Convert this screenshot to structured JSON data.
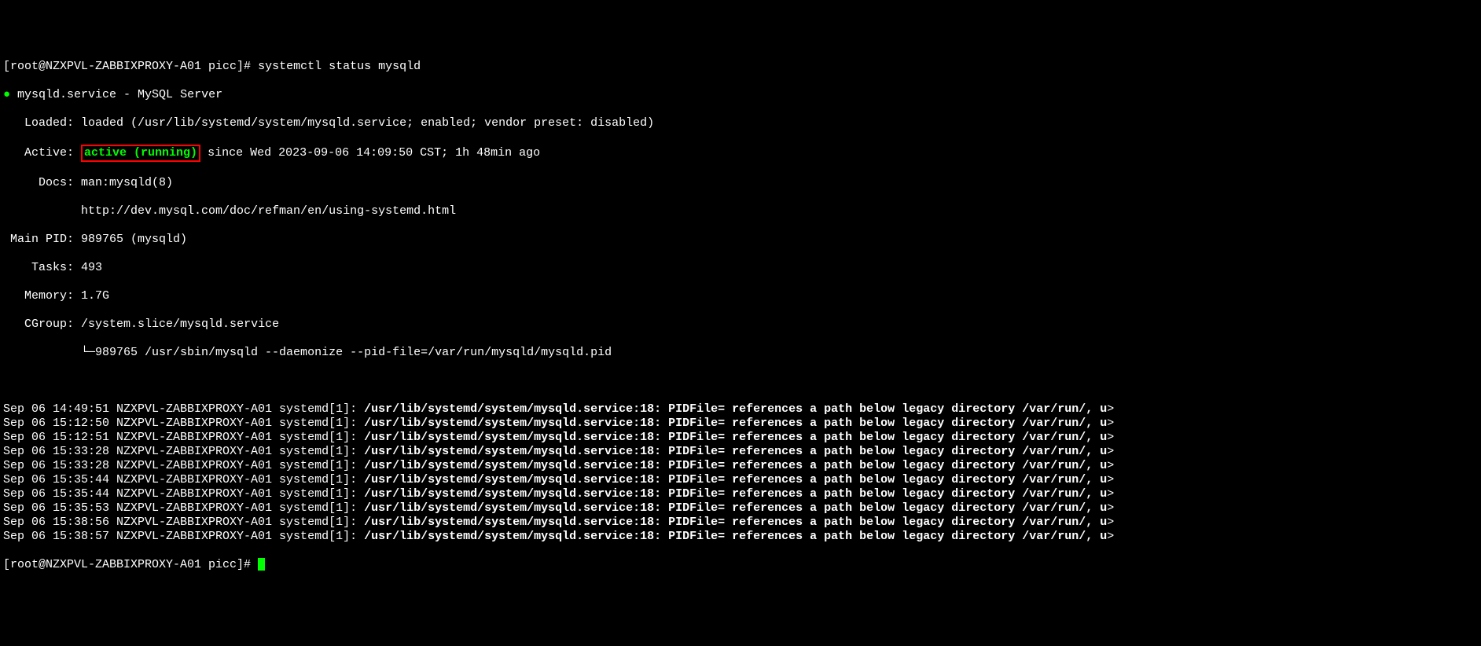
{
  "prompt1": "[root@NZXPVL-ZABBIXPROXY-A01 picc]# ",
  "command": "systemctl status mysqld",
  "service_line": "mysqld.service - MySQL Server",
  "bullet": "●",
  "loaded_label": "   Loaded: ",
  "loaded_value": "loaded (/usr/lib/systemd/system/mysqld.service; enabled; vendor preset: disabled)",
  "active_label": "   Active: ",
  "active_status": "active (running)",
  "active_since": " since Wed 2023-09-06 14:09:50 CST; 1h 48min ago",
  "docs_label": "     Docs: ",
  "docs_value1": "man:mysqld(8)",
  "docs_value2": "           http://dev.mysql.com/doc/refman/en/using-systemd.html",
  "mainpid_label": " Main PID: ",
  "mainpid_value": "989765 (mysqld)",
  "tasks_label": "    Tasks: ",
  "tasks_value": "493",
  "memory_label": "   Memory: ",
  "memory_value": "1.7G",
  "cgroup_label": "   CGroup: ",
  "cgroup_value": "/system.slice/mysqld.service",
  "cgroup_tree": "           └─989765 /usr/sbin/mysqld --daemonize --pid-file=/var/run/mysqld/mysqld.pid",
  "log_entries": [
    {
      "ts": "Sep 06 14:49:51 NZXPVL-ZABBIXPROXY-A01 systemd[1]: ",
      "msg": "/usr/lib/systemd/system/mysqld.service:18: PIDFile= references a path below legacy directory /var/run/, u",
      "trail": ">"
    },
    {
      "ts": "Sep 06 15:12:50 NZXPVL-ZABBIXPROXY-A01 systemd[1]: ",
      "msg": "/usr/lib/systemd/system/mysqld.service:18: PIDFile= references a path below legacy directory /var/run/, u",
      "trail": ">"
    },
    {
      "ts": "Sep 06 15:12:51 NZXPVL-ZABBIXPROXY-A01 systemd[1]: ",
      "msg": "/usr/lib/systemd/system/mysqld.service:18: PIDFile= references a path below legacy directory /var/run/, u",
      "trail": ">"
    },
    {
      "ts": "Sep 06 15:33:28 NZXPVL-ZABBIXPROXY-A01 systemd[1]: ",
      "msg": "/usr/lib/systemd/system/mysqld.service:18: PIDFile= references a path below legacy directory /var/run/, u",
      "trail": ">"
    },
    {
      "ts": "Sep 06 15:33:28 NZXPVL-ZABBIXPROXY-A01 systemd[1]: ",
      "msg": "/usr/lib/systemd/system/mysqld.service:18: PIDFile= references a path below legacy directory /var/run/, u",
      "trail": ">"
    },
    {
      "ts": "Sep 06 15:35:44 NZXPVL-ZABBIXPROXY-A01 systemd[1]: ",
      "msg": "/usr/lib/systemd/system/mysqld.service:18: PIDFile= references a path below legacy directory /var/run/, u",
      "trail": ">"
    },
    {
      "ts": "Sep 06 15:35:44 NZXPVL-ZABBIXPROXY-A01 systemd[1]: ",
      "msg": "/usr/lib/systemd/system/mysqld.service:18: PIDFile= references a path below legacy directory /var/run/, u",
      "trail": ">"
    },
    {
      "ts": "Sep 06 15:35:53 NZXPVL-ZABBIXPROXY-A01 systemd[1]: ",
      "msg": "/usr/lib/systemd/system/mysqld.service:18: PIDFile= references a path below legacy directory /var/run/, u",
      "trail": ">"
    },
    {
      "ts": "Sep 06 15:38:56 NZXPVL-ZABBIXPROXY-A01 systemd[1]: ",
      "msg": "/usr/lib/systemd/system/mysqld.service:18: PIDFile= references a path below legacy directory /var/run/, u",
      "trail": ">"
    },
    {
      "ts": "Sep 06 15:38:57 NZXPVL-ZABBIXPROXY-A01 systemd[1]: ",
      "msg": "/usr/lib/systemd/system/mysqld.service:18: PIDFile= references a path below legacy directory /var/run/, u",
      "trail": ">"
    }
  ],
  "prompt2": "[root@NZXPVL-ZABBIXPROXY-A01 picc]# "
}
